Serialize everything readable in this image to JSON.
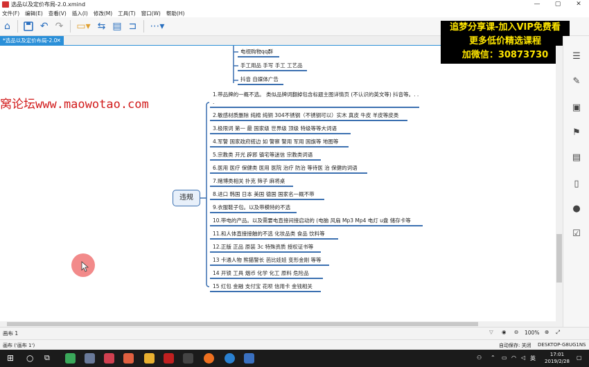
{
  "window": {
    "title": "选品以及定价布局-2.0.xmind",
    "controls": [
      "—",
      "▢",
      "✕"
    ]
  },
  "menu": [
    "文件(F)",
    "编辑(E)",
    "查看(V)",
    "插入(I)",
    "修改(M)",
    "工具(T)",
    "窗口(W)",
    "帮助(H)"
  ],
  "tab": {
    "label": "*选品以及定价布局-2.0",
    "close": "✕"
  },
  "watermark": "窝论坛www.maowotao.com",
  "promo": [
    "追梦分享课-加入VIP免费看",
    "更多低价精选课程",
    "加微信：30873730"
  ],
  "mindmap": {
    "central": "违规",
    "top_branches": [
      "电视购物qq群",
      "手工用品 手写 手工  工艺品",
      "抖音 自媒体广告"
    ],
    "branches": [
      "1.带品牌的一概不选。 类似品牌词翻掉包含标题主图详情页  (不认识的英文等) 抖音等。. . .",
      "2.敏感材质删除  纯棉 纯铜 304不锈钢（不锈钢可以）实木 真皮 牛皮 羊皮等皮类",
      "3.极限词 第一 最  国家级  世界级 顶级 特级等等大词语",
      "4.军警 国家政府搭边  如 警察  警用  军用  国旗等  地图等",
      "5.宗教类 开光 辟邪 镇宅等迷信  宗教类词语",
      "6.医用  医疗  保健类   医用  医院  治疗  防治  等待医  治  保健的词语",
      "7.赌博类相关 扑克  筛子  麻将桌",
      "8.进口  韩国  日本  美国  德国  国家名一概不带",
      "9.衣服鞋子包。以及带模特的不选",
      "10.带电的产品。以及需要电直接间接启动的  (电脑 风扇  Mp3  Mp4  电灯  u盘  储存卡等",
      "11.和人体直接接触的不选  化妆品类  食品  饮料等",
      "12.正版  正品  原装  3c  特殊资质  授权证书等",
      "13 卡通人物  熊猫警长  芭比娃娃  变形金刚  等等",
      "14  开锁  工具  烟币  化学  化工  原料  危险品",
      "15  红包  金融  支付宝  花呗  信用卡  金钱相关"
    ]
  },
  "status": {
    "filter": "▽",
    "zoom": "100%",
    "autosave": "自动保存: 关闭",
    "computer": "DESKTOP-G8UG1NS"
  },
  "sheet": {
    "label": "画布 1",
    "sublabel": "画布 ('画布 1')"
  },
  "taskbar": {
    "time": "17:01",
    "date": "2019/2/28",
    "lang": "英"
  },
  "colors": {
    "accent": "#2a8fd8",
    "branch_line": "#3a6fb0",
    "watermark": "#d11a1a",
    "promo_bg": "#000000",
    "promo_text": "#ffe600"
  }
}
